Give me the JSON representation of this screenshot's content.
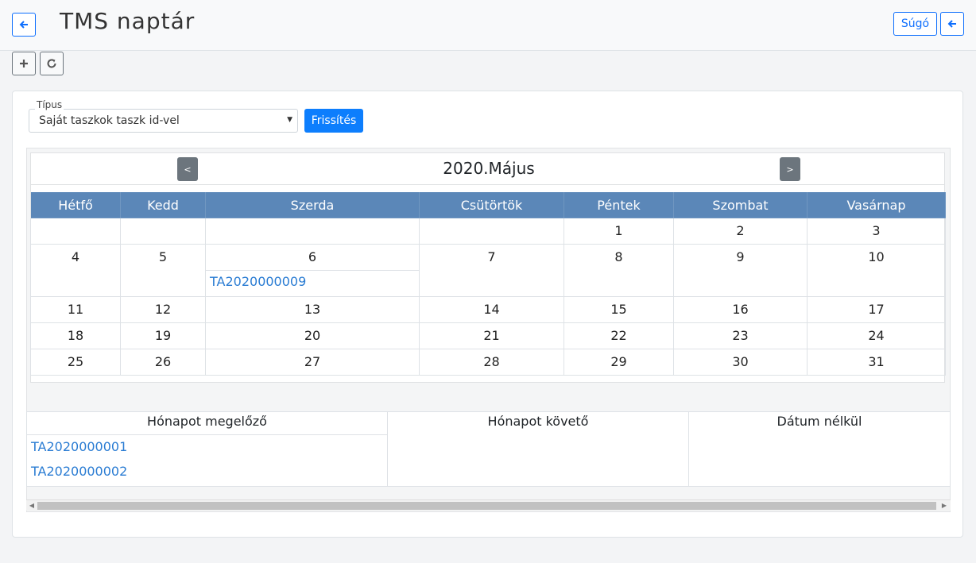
{
  "header": {
    "title": "TMS naptár",
    "help_label": "Súgó"
  },
  "filter": {
    "type_label": "Típus",
    "type_value": "Saját taszkok taszk id-vel",
    "refresh_label": "Frissítés"
  },
  "calendar": {
    "month_title": "2020.Május",
    "prev_label": "<",
    "next_label": ">",
    "weekdays": [
      "Hétfő",
      "Kedd",
      "Szerda",
      "Csütörtök",
      "Péntek",
      "Szombat",
      "Vasárnap"
    ],
    "weeks": [
      [
        "",
        "",
        "",
        "",
        "1",
        "2",
        "3"
      ],
      [
        "4",
        "5",
        "6",
        "7",
        "8",
        "9",
        "10"
      ],
      [
        "11",
        "12",
        "13",
        "14",
        "15",
        "16",
        "17"
      ],
      [
        "18",
        "19",
        "20",
        "21",
        "22",
        "23",
        "24"
      ],
      [
        "25",
        "26",
        "27",
        "28",
        "29",
        "30",
        "31"
      ]
    ],
    "tasks": [
      {
        "day": "6",
        "id": "TA2020000009"
      }
    ]
  },
  "lists": {
    "before_title": "Hónapot megelőző",
    "before_items": [
      "TA2020000001",
      "TA2020000002"
    ],
    "after_title": "Hónapot követő",
    "nodate_title": "Dátum nélkül"
  },
  "icons": {
    "back": "arrow-left-icon",
    "add": "plus-icon",
    "refresh": "rotate-right-icon"
  }
}
